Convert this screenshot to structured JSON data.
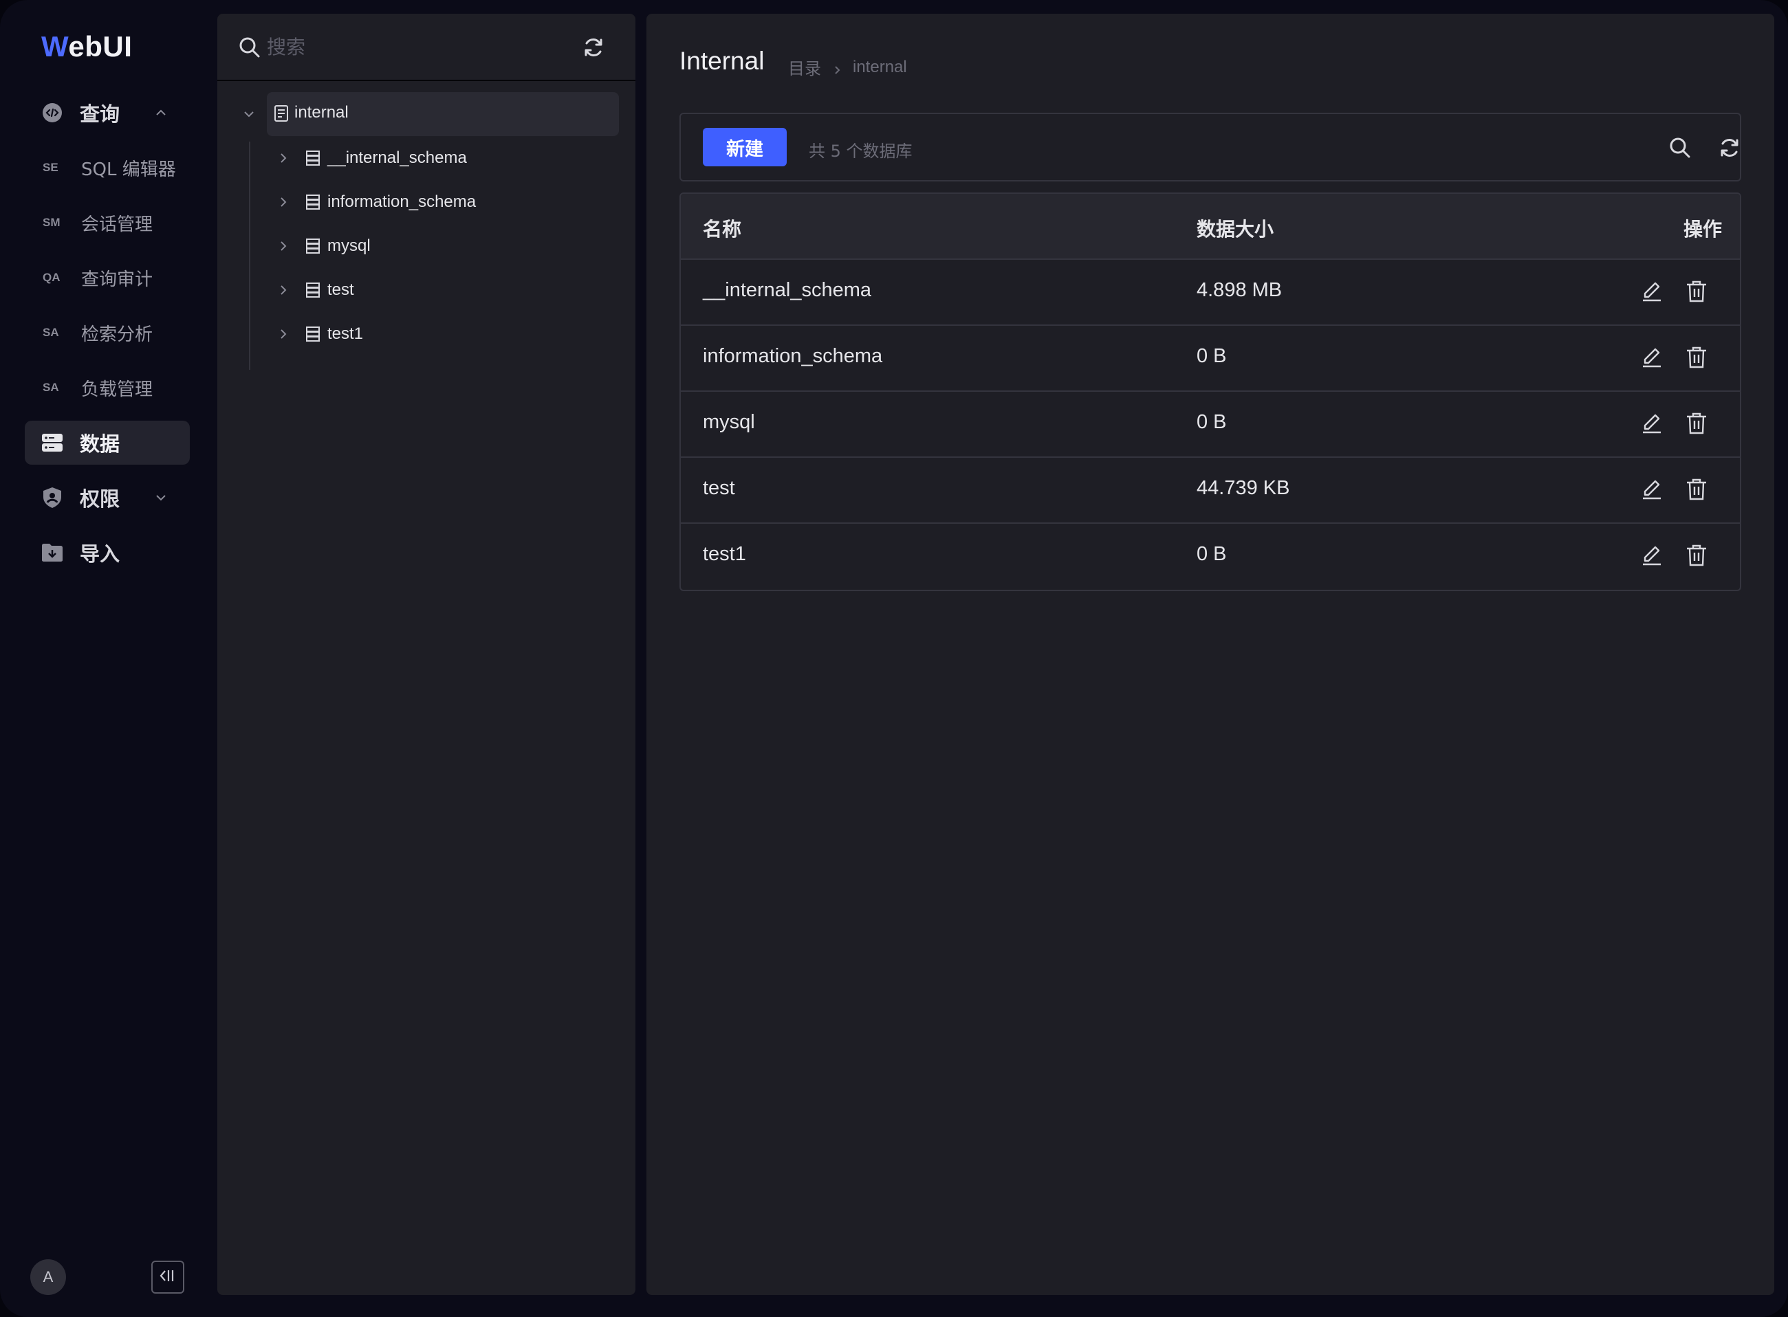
{
  "app": {
    "logo_first": "W",
    "logo_rest": "ebUI"
  },
  "sidebar": {
    "items": [
      {
        "label": "查询",
        "icon": "code-bubble-icon",
        "expanded": true
      },
      {
        "abbr": "SE",
        "label": "SQL 编辑器"
      },
      {
        "abbr": "SM",
        "label": "会话管理"
      },
      {
        "abbr": "QA",
        "label": "查询审计"
      },
      {
        "abbr": "SA",
        "label": "检索分析"
      },
      {
        "abbr": "SA",
        "label": "负载管理"
      },
      {
        "label": "数据",
        "icon": "database-icon",
        "active": true
      },
      {
        "label": "权限",
        "icon": "shield-icon",
        "expanded": false
      },
      {
        "label": "导入",
        "icon": "folder-download-icon"
      }
    ],
    "avatar_initial": "A"
  },
  "tree": {
    "search_placeholder": "搜索",
    "root": "internal",
    "nodes": [
      "__internal_schema",
      "information_schema",
      "mysql",
      "test",
      "test1"
    ]
  },
  "main": {
    "title": "Internal",
    "breadcrumb": [
      "目录",
      "internal"
    ],
    "new_button": "新建",
    "count_text": "共 5 个数据库",
    "columns": {
      "name": "名称",
      "size": "数据大小",
      "actions": "操作"
    },
    "rows": [
      {
        "name": "__internal_schema",
        "size": "4.898 MB"
      },
      {
        "name": "information_schema",
        "size": "0 B"
      },
      {
        "name": "mysql",
        "size": "0 B"
      },
      {
        "name": "test",
        "size": "44.739 KB"
      },
      {
        "name": "test1",
        "size": "0 B"
      }
    ]
  },
  "colors": {
    "accent": "#3f5fff",
    "background": "#0b0b18",
    "panel": "#1e1e25"
  }
}
